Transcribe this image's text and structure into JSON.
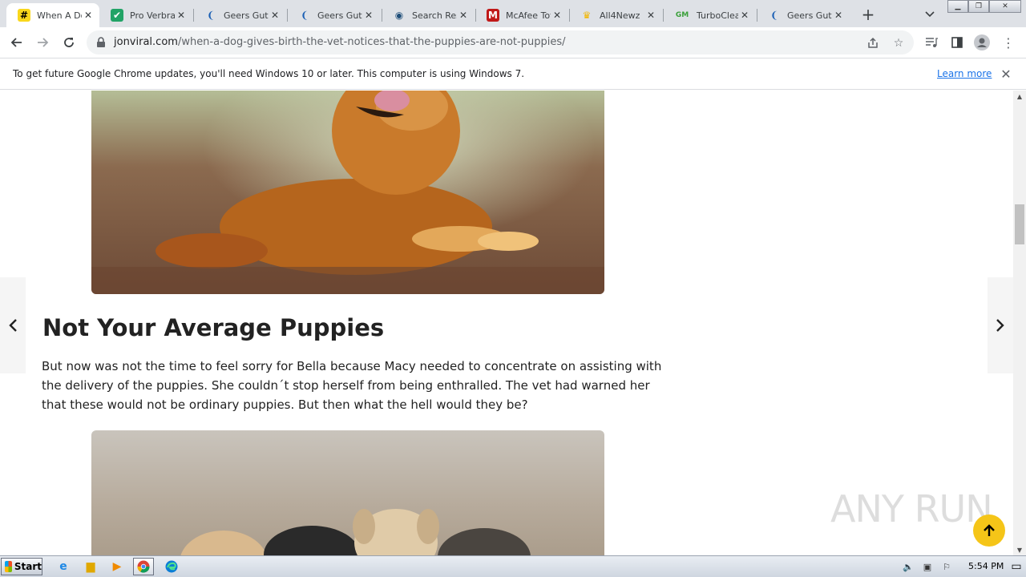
{
  "browser": {
    "tabs": [
      {
        "title": "When A Dog Gives Birth",
        "favicon": "hash-icon",
        "fav_glyph": "#",
        "fav_bg": "#f9d71c",
        "fav_color": "#000",
        "active": true
      },
      {
        "title": "Pro Verbrauch",
        "favicon": "shield-check-icon",
        "fav_glyph": "✔",
        "fav_bg": "#21a366",
        "fav_color": "#fff",
        "active": false
      },
      {
        "title": "Geers Gutschein",
        "favicon": "ear-icon",
        "fav_glyph": "❨",
        "fav_bg": "transparent",
        "fav_color": "#1a5fb4",
        "active": false
      },
      {
        "title": "Geers Gutschein",
        "favicon": "ear-icon",
        "fav_glyph": "❨",
        "fav_bg": "transparent",
        "fav_color": "#1a5fb4",
        "active": false
      },
      {
        "title": "Search Results",
        "favicon": "search-globe-icon",
        "fav_glyph": "◉",
        "fav_bg": "transparent",
        "fav_color": "#1f4e79",
        "active": false
      },
      {
        "title": "McAfee Total Protection",
        "favicon": "mcafee-shield-icon",
        "fav_glyph": "M",
        "fav_bg": "#c01818",
        "fav_color": "#fff",
        "active": false
      },
      {
        "title": "All4Newz",
        "favicon": "crown-icon",
        "fav_glyph": "♛",
        "fav_bg": "transparent",
        "fav_color": "#f2b600",
        "active": false
      },
      {
        "title": "TurboCleaner",
        "favicon": "gm-icon",
        "fav_glyph": "GM",
        "fav_bg": "transparent",
        "fav_color": "#3aa03a",
        "active": false
      },
      {
        "title": "Geers Gutschein",
        "favicon": "ear-icon",
        "fav_glyph": "❨",
        "fav_bg": "transparent",
        "fav_color": "#1a5fb4",
        "active": false
      }
    ],
    "address": {
      "domain": "jonviral.com",
      "path": "/when-a-dog-gives-birth-the-vet-notices-that-the-puppies-are-not-puppies/"
    },
    "infobar": {
      "message": "To get future Google Chrome updates, you'll need Windows 10 or later. This computer is using Windows 7.",
      "link": "Learn more"
    }
  },
  "article": {
    "heading": "Not Your Average Puppies",
    "paragraph": "But now was not the time to feel sorry for Bella because Macy needed to concentrate on assisting with the delivery of the puppies. She couldn´t stop herself from being enthralled. The vet had warned her that these would not be ordinary puppies. But then what the hell would they be?"
  },
  "watermark": "ANY RUN",
  "taskbar": {
    "start_label": "Start",
    "clock": "5:54 PM"
  }
}
